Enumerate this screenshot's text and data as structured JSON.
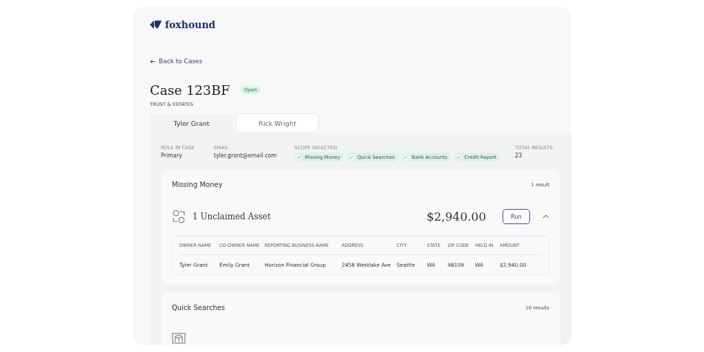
{
  "brand": {
    "name": "foxhound"
  },
  "back_link": "Back to Cases",
  "case": {
    "title": "Case 123BF",
    "status": "Open",
    "category": "TRUST & ESTATES"
  },
  "tabs": [
    {
      "label": "Tyler Grant",
      "selected": true
    },
    {
      "label": "Rick Wright",
      "selected": false
    }
  ],
  "summary": {
    "role_label": "ROLE IN CASE",
    "role": "Primary",
    "email_label": "EMAIL",
    "email": "tyler.grant@email.com",
    "scope_label": "SCOPE SELECTED",
    "scopes": [
      {
        "label": "Missing Money",
        "checked": true
      },
      {
        "label": "Quick Searches",
        "checked": true
      },
      {
        "label": "Bank Accounts",
        "checked": true
      },
      {
        "label": "Credit Report",
        "checked": true
      }
    ],
    "total_label": "TOTAL RESULTS",
    "total": "23"
  },
  "sections": [
    {
      "title": "Missing Money",
      "count": "1 result",
      "item": {
        "kind": "money",
        "title": "1 Unclaimed Asset",
        "amount": "$2,940.00",
        "button": "Run",
        "expanded": true,
        "table": {
          "columns": [
            "OWNER NAME",
            "CO-OWNER NAME",
            "REPORTING BUSINESS NAME",
            "ADDRESS",
            "CITY",
            "STATE",
            "ZIP CODE",
            "HELD IN",
            "AMOUNT"
          ],
          "rows": [
            [
              "Tyler Grant",
              "Emily Grant",
              "Horizon Financial Group",
              "2458 Westlake Ave",
              "Seattle",
              "WA",
              "98109",
              "WA",
              "$2,940.00"
            ]
          ]
        }
      }
    },
    {
      "title": "Quick Searches",
      "count": "10 results",
      "item": {
        "kind": "bank"
      }
    }
  ]
}
